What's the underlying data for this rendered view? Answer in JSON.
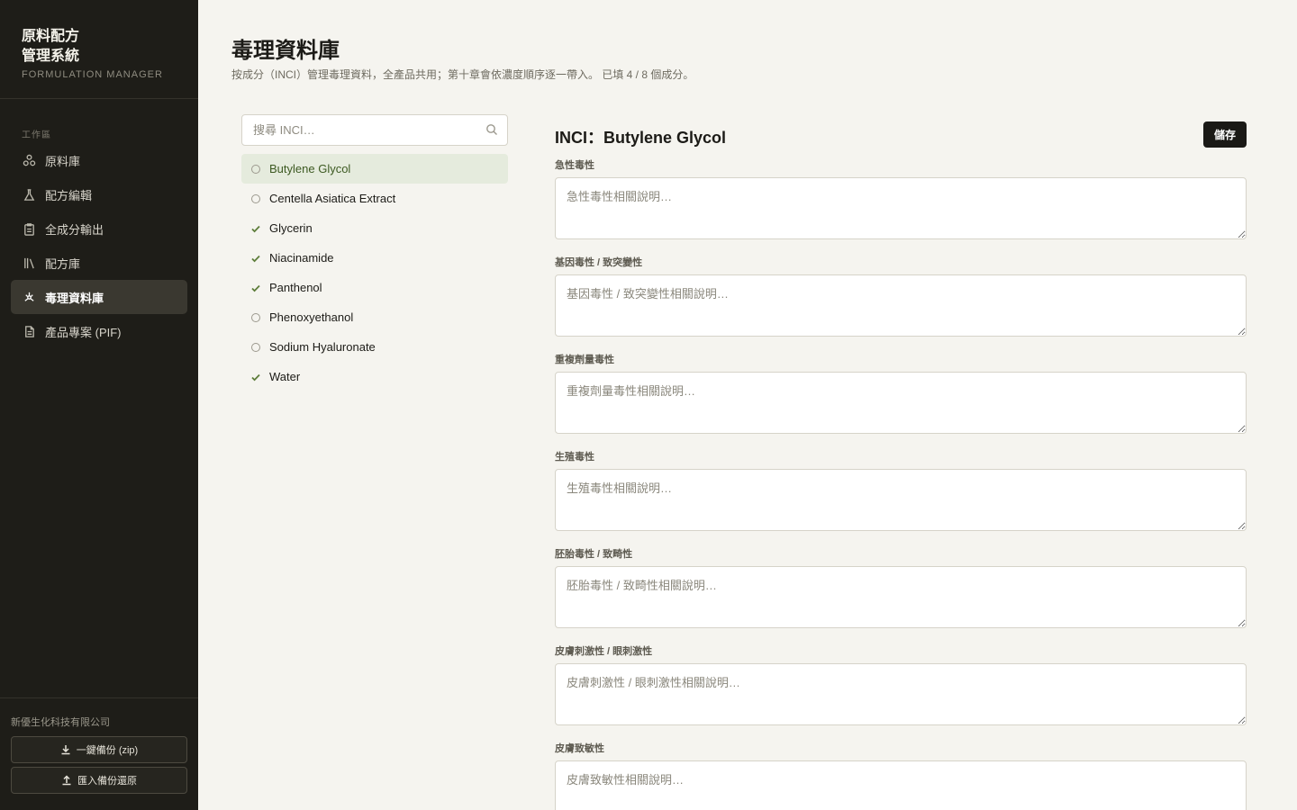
{
  "brand": {
    "title_line1": "原料配方",
    "title_line2": "管理系統",
    "subtitle": "FORMULATION MANAGER"
  },
  "sidebar": {
    "section_label": "工作區",
    "items": [
      {
        "label": "原料庫",
        "icon": "molecule-icon"
      },
      {
        "label": "配方編輯",
        "icon": "flask-icon"
      },
      {
        "label": "全成分輸出",
        "icon": "clipboard-icon"
      },
      {
        "label": "配方庫",
        "icon": "library-icon"
      },
      {
        "label": "毒理資料庫",
        "icon": "biohazard-icon",
        "active": true
      },
      {
        "label": "產品專案 (PIF)",
        "icon": "document-icon"
      }
    ],
    "company": "新優生化科技有限公司",
    "backup_label": "一鍵備份 (zip)",
    "restore_label": "匯入備份還原"
  },
  "page": {
    "title": "毒理資料庫",
    "description": "按成分（INCI）管理毒理資料，全產品共用；第十章會依濃度順序逐一帶入。 已填 4 / 8 個成分。"
  },
  "search": {
    "placeholder": "搜尋 INCI…",
    "value": ""
  },
  "ingredients": [
    {
      "name": "Butylene Glycol",
      "filled": false,
      "selected": true
    },
    {
      "name": "Centella Asiatica Extract",
      "filled": false
    },
    {
      "name": "Glycerin",
      "filled": true
    },
    {
      "name": "Niacinamide",
      "filled": true
    },
    {
      "name": "Panthenol",
      "filled": true
    },
    {
      "name": "Phenoxyethanol",
      "filled": false
    },
    {
      "name": "Sodium Hyaluronate",
      "filled": false
    },
    {
      "name": "Water",
      "filled": true
    }
  ],
  "detail": {
    "title": "INCI：Butylene Glycol",
    "save_label": "儲存",
    "fields": [
      {
        "label": "急性毒性",
        "placeholder": "急性毒性相關說明…",
        "value": ""
      },
      {
        "label": "基因毒性 / 致突變性",
        "placeholder": "基因毒性 / 致突變性相關說明…",
        "value": ""
      },
      {
        "label": "重複劑量毒性",
        "placeholder": "重複劑量毒性相關說明…",
        "value": ""
      },
      {
        "label": "生殖毒性",
        "placeholder": "生殖毒性相關說明…",
        "value": ""
      },
      {
        "label": "胚胎毒性 / 致畸性",
        "placeholder": "胚胎毒性 / 致畸性相關說明…",
        "value": ""
      },
      {
        "label": "皮膚刺激性 / 眼刺激性",
        "placeholder": "皮膚刺激性 / 眼刺激性相關說明…",
        "value": ""
      },
      {
        "label": "皮膚致敏性",
        "placeholder": "皮膚致敏性相關說明…",
        "value": ""
      }
    ]
  },
  "colors": {
    "sidebar_bg": "#1e1d18",
    "accent_green": "#5d7d3a",
    "selected_bg": "#e5ebdd",
    "page_bg": "#f5f4ef"
  }
}
